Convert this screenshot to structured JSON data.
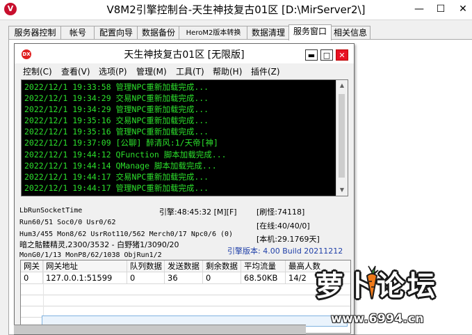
{
  "window": {
    "title": "V8M2引擎控制台-天生神技复古01区 [D:\\MirServer2\\]",
    "app_icon": "V",
    "minimize": "—",
    "maximize": "☐",
    "close": "✕"
  },
  "tabs": [
    {
      "label": "服务器控制"
    },
    {
      "label": "帐号"
    },
    {
      "label": "配置向导"
    },
    {
      "label": "数据备份"
    },
    {
      "label": "HeroM2版本转换"
    },
    {
      "label": "数据清理"
    },
    {
      "label": "服务窗口",
      "active": true
    },
    {
      "label": "相关信息"
    }
  ],
  "inner_window": {
    "title": "天生神技复古01区 [无限版]",
    "icon": "DX",
    "minimize": "▬",
    "maximize": "□",
    "close": "✕"
  },
  "menu": [
    {
      "label": "控制(C)"
    },
    {
      "label": "查看(V)"
    },
    {
      "label": "选项(P)"
    },
    {
      "label": "管理(M)"
    },
    {
      "label": "工具(T)"
    },
    {
      "label": "帮助(H)"
    },
    {
      "label": "插件(Z)"
    }
  ],
  "log_lines": [
    "2022/12/1 19:33:58 管理NPC重新加载完成...",
    "2022/12/1 19:34:29 交易NPC重新加载完成...",
    "2022/12/1 19:34:29 管理NPC重新加载完成...",
    "2022/12/1 19:35:16 交易NPC重新加载完成...",
    "2022/12/1 19:35:16 管理NPC重新加载完成...",
    "2022/12/1 19:37:09 [公聊] 醉清风:1/天帝[神]",
    "2022/12/1 19:44:12 QFunction 脚本加载完成...",
    "2022/12/1 19:44:14 QManage 脚本加载完成...",
    "2022/12/1 19:44:17 交易NPC重新加载完成...",
    "2022/12/1 19:44:17 管理NPC重新加载完成..."
  ],
  "status": {
    "socket_label": "LbRunSocketTime",
    "engine_time": "引擎:48:45:32 [M][F]",
    "refresh_monsters": "[刷怪:74118]",
    "run_line": "Run60/51 Soc0/0 Usr0/62",
    "online": "[在线:40/40/0]",
    "hum_line": "Hum3/455 Mon8/62 UsrRot110/562 Merch0/17 Npc0/6 (0)",
    "local": "[本机:29.1769天]",
    "monster_line": "暗之骷髅精灵,2300/3532 - 白野猪1/3090/20",
    "version": "引擎版本: 4.00 Build 20211212",
    "mon_line": "MonG0/1/13 MonP8/62/1038 ObjRun1/2"
  },
  "gateway_table": {
    "headers": [
      "网关",
      "网关地址",
      "队列数据",
      "发送数据",
      "剩余数据",
      "平均流量",
      "最高人数"
    ],
    "rows": [
      [
        "0",
        "127.0.0.1:51599",
        "0",
        "36",
        "0",
        "68.50KB",
        "14/2"
      ]
    ]
  },
  "watermark": {
    "title": "萝卜论坛",
    "url": "www.6994.cn"
  },
  "colors": {
    "log_text": "#2ce02c",
    "log_background": "#000000",
    "version_text": "#1f3fa8",
    "close_red": "#e81123"
  }
}
